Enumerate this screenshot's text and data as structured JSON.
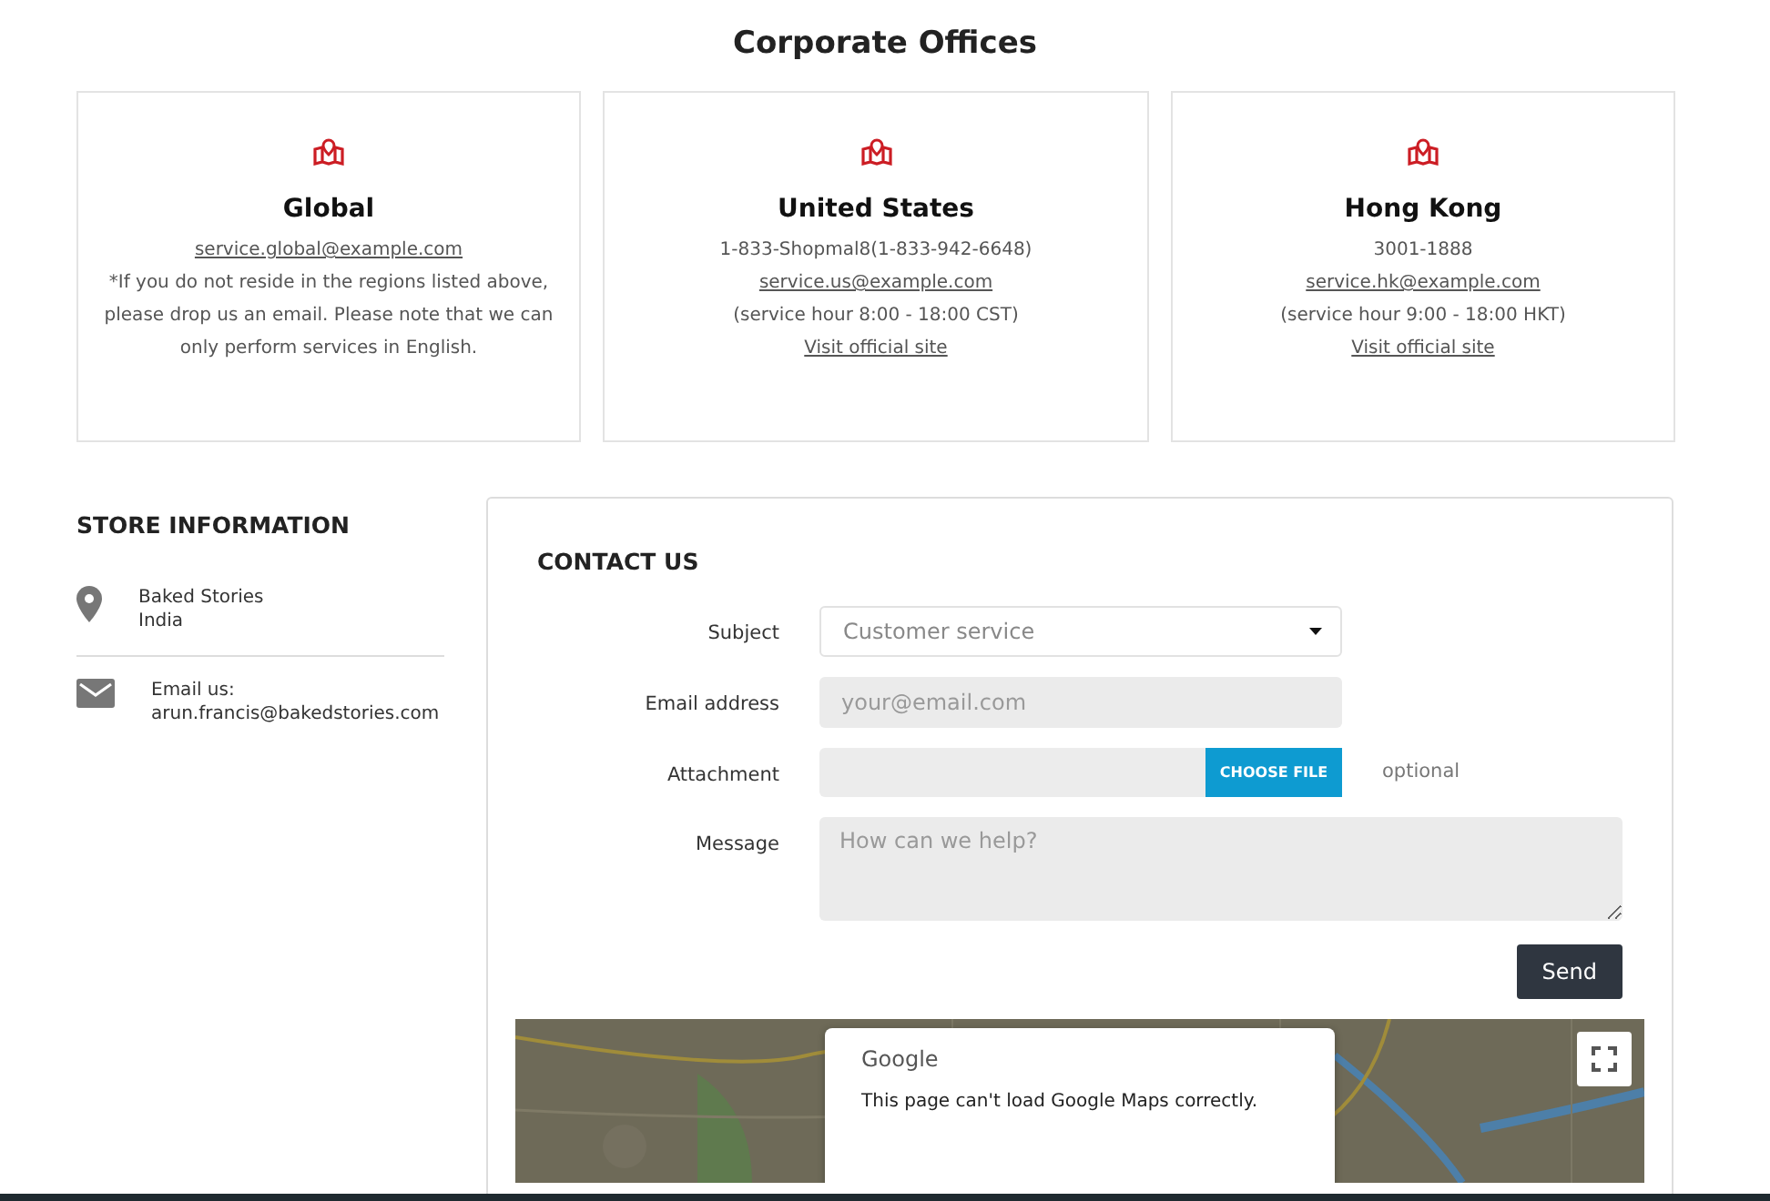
{
  "title": "Corporate Offices",
  "offices": [
    {
      "name": "Global",
      "lines": [
        {
          "kind": "link",
          "text": "service.global@example.com"
        },
        {
          "kind": "text",
          "text": "*If you do not reside in the regions listed above, please drop us an email. Please note that we can only perform services in English."
        }
      ]
    },
    {
      "name": "United States",
      "lines": [
        {
          "kind": "text",
          "text": "1-833-Shopmal8(1-833-942-6648)"
        },
        {
          "kind": "link",
          "text": "service.us@example.com"
        },
        {
          "kind": "text",
          "text": "(service hour 8:00 - 18:00 CST)"
        },
        {
          "kind": "link",
          "text": "Visit official site"
        }
      ]
    },
    {
      "name": "Hong Kong",
      "lines": [
        {
          "kind": "text",
          "text": "3001-1888"
        },
        {
          "kind": "link",
          "text": "service.hk@example.com"
        },
        {
          "kind": "text",
          "text": "(service hour 9:00 - 18:00 HKT)"
        },
        {
          "kind": "link",
          "text": "Visit official site"
        }
      ]
    }
  ],
  "store": {
    "heading": "STORE INFORMATION",
    "items": [
      {
        "kind": "location",
        "lines": [
          "Baked Stories",
          "India"
        ]
      },
      {
        "kind": "email",
        "lines": [
          "Email us:",
          "arun.francis@bakedstories.com"
        ]
      }
    ]
  },
  "contact": {
    "heading": "CONTACT US",
    "fields": [
      {
        "kind": "select",
        "label": "Subject",
        "value": "Customer service"
      },
      {
        "kind": "input",
        "label": "Email address",
        "placeholder": "your@email.com"
      },
      {
        "kind": "file",
        "label": "Attachment",
        "button": "CHOOSE FILE",
        "note": "optional"
      },
      {
        "kind": "textarea",
        "label": "Message",
        "placeholder": "How can we help?"
      }
    ],
    "send": "Send"
  },
  "map": {
    "kind": "picture",
    "dialog": {
      "brand": "Google",
      "message": "This page can't load Google Maps correctly."
    }
  }
}
